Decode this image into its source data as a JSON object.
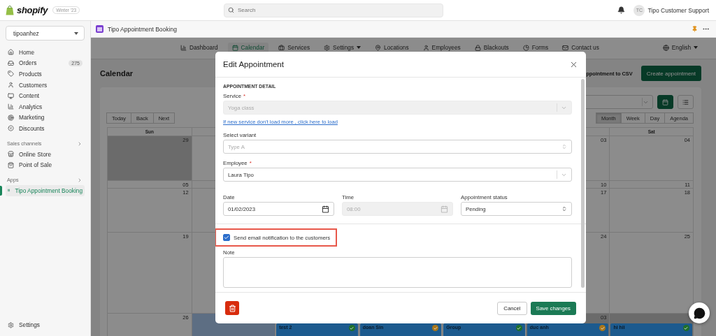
{
  "top_bar": {
    "logo_text": "shopify",
    "edition_badge": "Winter '23",
    "search": {
      "placeholder": "Search"
    },
    "user": {
      "initials": "TC",
      "name": "Tipo Customer Support"
    }
  },
  "sidebar": {
    "store": "tipoanhez",
    "items": [
      {
        "label": "Home",
        "selected": false
      },
      {
        "label": "Orders",
        "badge": "275",
        "selected": false
      },
      {
        "label": "Products",
        "selected": false
      },
      {
        "label": "Customers",
        "selected": false
      },
      {
        "label": "Content",
        "selected": false
      },
      {
        "label": "Analytics",
        "selected": false
      },
      {
        "label": "Marketing",
        "selected": false
      },
      {
        "label": "Discounts",
        "selected": false
      }
    ],
    "sections": [
      {
        "title": "Sales channels",
        "items": [
          {
            "label": "Online Store",
            "selected": false
          },
          {
            "label": "Point of Sale",
            "selected": false
          }
        ]
      },
      {
        "title": "Apps",
        "items": [
          {
            "label": "Tipo Appointment Booking",
            "selected": true
          }
        ]
      }
    ],
    "footer_item": "Settings"
  },
  "app_header": {
    "title": "Tipo Appointment Booking"
  },
  "app_nav": {
    "items": [
      {
        "label": "Dashboard",
        "selected": false
      },
      {
        "label": "Calendar",
        "selected": true
      },
      {
        "label": "Services",
        "selected": false
      },
      {
        "label": "Settings",
        "selected": false,
        "has_menu": true
      },
      {
        "label": "Locations",
        "selected": false
      },
      {
        "label": "Employees",
        "selected": false
      },
      {
        "label": "Blackouts",
        "selected": false
      },
      {
        "label": "Forms",
        "selected": false
      },
      {
        "label": "Contact us",
        "selected": false
      }
    ],
    "language": "English"
  },
  "page": {
    "title": "Calendar",
    "export_link": "ppointment to CSV",
    "create_button": "Create appointment"
  },
  "calendar": {
    "nav_buttons": [
      "Today",
      "Back",
      "Next"
    ],
    "views": [
      {
        "label": "Month",
        "selected": true
      },
      {
        "label": "Week",
        "selected": false
      },
      {
        "label": "Day",
        "selected": false
      },
      {
        "label": "Agenda",
        "selected": false
      }
    ],
    "weekdays": {
      "sun": "Sun",
      "sat": "Sat"
    },
    "weeks": [
      {
        "sun": {
          "day": "29",
          "outside": true,
          "today": false
        },
        "fri": {
          "day": "03",
          "outside": false,
          "today": false
        },
        "sat": {
          "day": "04",
          "outside": false,
          "today": false
        }
      },
      {
        "sun": {
          "day": "05",
          "outside": false,
          "today": false
        },
        "fri": {
          "day": "10",
          "outside": false,
          "today": false
        },
        "sat": {
          "day": "11",
          "outside": false,
          "today": false
        }
      },
      {
        "sun": {
          "day": "12",
          "outside": false,
          "today": false
        },
        "fri": {
          "day": "17",
          "outside": false,
          "today": false
        },
        "sat": {
          "day": "18",
          "outside": false,
          "today": false
        }
      },
      {
        "sun": {
          "day": "19",
          "outside": false,
          "today": false
        },
        "fri": {
          "day": "24",
          "outside": false,
          "today": false
        },
        "sat": {
          "day": "25",
          "outside": false,
          "today": false
        }
      },
      {
        "sun": {
          "day": "26",
          "outside": false,
          "today": false
        },
        "mon": {
          "outside": false,
          "today": true
        },
        "tue": {
          "outside": false,
          "today": false,
          "event": {
            "title": "test 2",
            "color": "#1e6e2a"
          }
        },
        "wed": {
          "outside": false,
          "today": false,
          "event": {
            "title": "doan Sin",
            "color": "#a8751a"
          }
        },
        "thu": {
          "outside": false,
          "today": false,
          "event": {
            "title": "Group",
            "color": "#1e6e2a"
          }
        },
        "fri": {
          "day": "03",
          "outside": true,
          "today": false,
          "event": {
            "title": "duc anh",
            "color": "#a8751a"
          }
        },
        "sat": {
          "outside": true,
          "today": false,
          "event": {
            "title": "hi hii",
            "color": "#1e6e2a"
          }
        }
      }
    ]
  },
  "modal": {
    "title": "Edit Appointment",
    "section_title": "APPOINTMENT DETAIL",
    "service": {
      "label": "Service",
      "required_mark": "*",
      "value": "Yoga class",
      "disabled": true
    },
    "reload_link": "If new service don't load more , click here to load",
    "variant": {
      "label": "Select variant",
      "placeholder": "Type A",
      "disabled": false
    },
    "employee": {
      "label": "Employee",
      "required_mark": "*",
      "value": "Laura Tipo",
      "disabled": false
    },
    "date": {
      "label": "Date",
      "value": "01/02/2023",
      "disabled": false
    },
    "time": {
      "label": "Time",
      "value": "08:00",
      "disabled": true
    },
    "status": {
      "label": "Appointment status",
      "value": "Pending",
      "disabled": false
    },
    "notify": {
      "label": "Send email notification to the customers",
      "checked": true,
      "highlighted": true
    },
    "note": {
      "label": "Note"
    },
    "cancel_button": "Cancel",
    "save_button": "Save changes"
  }
}
